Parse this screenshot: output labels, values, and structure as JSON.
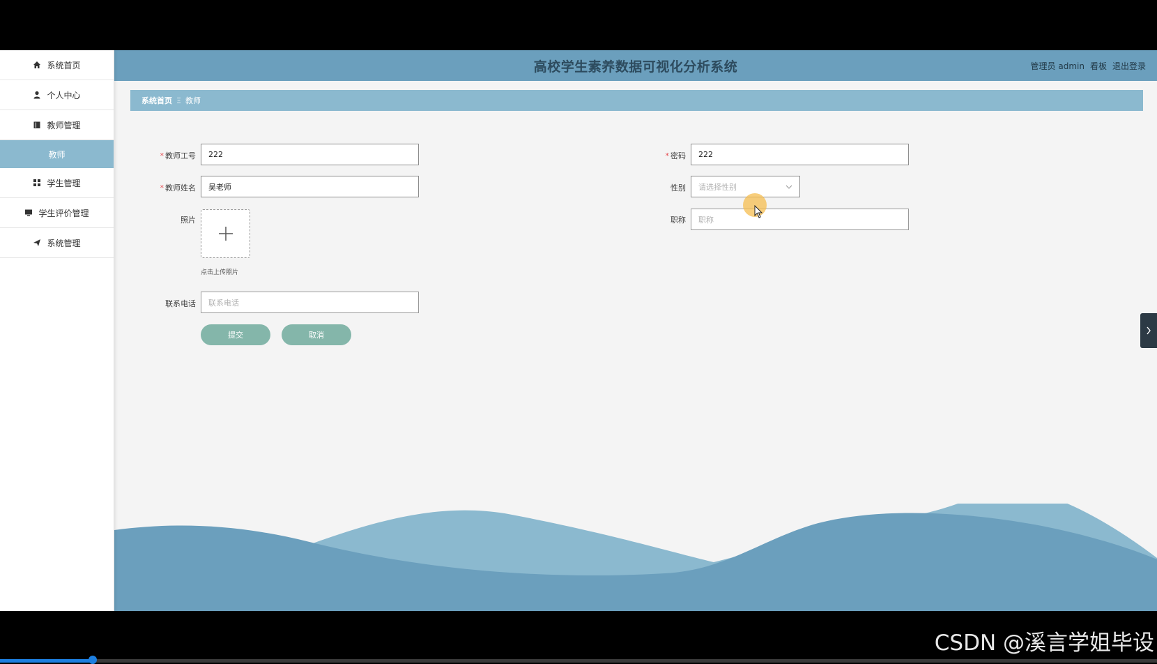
{
  "app": {
    "title": "高校学生素养数据可视化分析系统",
    "accent_color": "#6b9fbd",
    "sub_color": "#8bb9cf",
    "button_color": "#84b6aa"
  },
  "header": {
    "user_label": "管理员 admin",
    "dashboard_link": "看板",
    "logout_link": "退出登录"
  },
  "sidebar": {
    "items": [
      {
        "label": "系统首页",
        "icon": "home-icon"
      },
      {
        "label": "个人中心",
        "icon": "user-icon"
      },
      {
        "label": "教师管理",
        "icon": "book-icon"
      },
      {
        "label": "学生管理",
        "icon": "grid-icon"
      },
      {
        "label": "学生评价管理",
        "icon": "monitor-icon"
      },
      {
        "label": "系统管理",
        "icon": "send-icon"
      }
    ],
    "sub_item": {
      "label": "教师"
    }
  },
  "breadcrumb": {
    "home": "系统首页",
    "separator": "Ξ",
    "current": "教师"
  },
  "form": {
    "teacher_id": {
      "label": "教师工号",
      "value": "222",
      "required": true
    },
    "password": {
      "label": "密码",
      "value": "222",
      "required": true
    },
    "teacher_name": {
      "label": "教师姓名",
      "value": "吴老师",
      "required": true
    },
    "gender": {
      "label": "性别",
      "placeholder": "请选择性别"
    },
    "photo": {
      "label": "照片",
      "tip": "点击上传照片"
    },
    "title": {
      "label": "职称",
      "placeholder": "职称"
    },
    "phone": {
      "label": "联系电话",
      "placeholder": "联系电话"
    },
    "submit_label": "提交",
    "cancel_label": "取消"
  },
  "footer": {
    "watermark": "CSDN @溪言学姐毕设",
    "progress_fraction": 0.08
  }
}
